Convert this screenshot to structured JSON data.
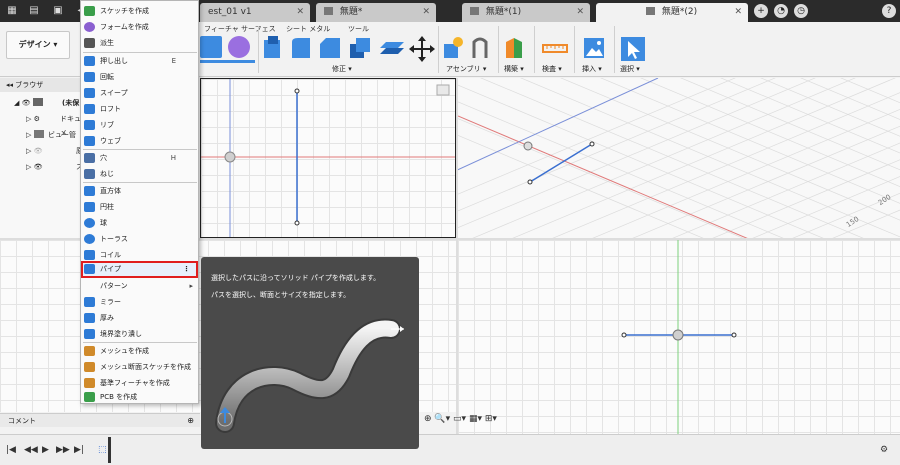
{
  "tabs": [
    {
      "label": "est_01 v1"
    },
    {
      "label": "無題*"
    },
    {
      "label": "無題*(1)"
    },
    {
      "label": "無題*(2)"
    }
  ],
  "toolbar": {
    "workspace_label": "デザイン ▾",
    "subtabs": [
      "フィーチャ サーフェス",
      "シート メタル",
      "ツール"
    ],
    "groups": [
      "修正 ▾",
      "アセンブリ ▾",
      "構築 ▾",
      "検査 ▾",
      "挿入 ▾",
      "選択 ▾"
    ]
  },
  "browser": {
    "title": "ブラウザ",
    "items": [
      "(未保",
      "ドキュメ",
      "ビュー管",
      "原",
      "ス"
    ]
  },
  "comments_label": "コメント",
  "menu": {
    "items": [
      {
        "label": "スケッチを作成",
        "shortcut": "",
        "icon_color": "#3a9e4a"
      },
      {
        "label": "フォームを作成",
        "shortcut": "",
        "icon_color": "#8a5fd0"
      },
      {
        "label": "派生",
        "shortcut": "",
        "icon_color": "#555555"
      },
      {
        "label": "押し出し",
        "shortcut": "E",
        "icon_color": "#2e7bd6"
      },
      {
        "label": "回転",
        "shortcut": "",
        "icon_color": "#2e7bd6"
      },
      {
        "label": "スイープ",
        "shortcut": "",
        "icon_color": "#2e7bd6"
      },
      {
        "label": "ロフト",
        "shortcut": "",
        "icon_color": "#2e7bd6"
      },
      {
        "label": "リブ",
        "shortcut": "",
        "icon_color": "#2e7bd6"
      },
      {
        "label": "ウェブ",
        "shortcut": "",
        "icon_color": "#2e7bd6"
      },
      {
        "label": "穴",
        "shortcut": "H",
        "icon_color": "#4a6fa5"
      },
      {
        "label": "ねじ",
        "shortcut": "",
        "icon_color": "#4a6fa5"
      },
      {
        "label": "直方体",
        "shortcut": "",
        "icon_color": "#2e7bd6"
      },
      {
        "label": "円柱",
        "shortcut": "",
        "icon_color": "#2e7bd6"
      },
      {
        "label": "球",
        "shortcut": "",
        "icon_color": "#2e7bd6"
      },
      {
        "label": "トーラス",
        "shortcut": "",
        "icon_color": "#2e7bd6"
      },
      {
        "label": "コイル",
        "shortcut": "",
        "icon_color": "#2e7bd6"
      },
      {
        "label": "パイプ",
        "shortcut": "",
        "icon_color": "#2e7bd6"
      },
      {
        "label": "パターン",
        "shortcut": "▸",
        "icon_color": ""
      },
      {
        "label": "ミラー",
        "shortcut": "",
        "icon_color": "#2e7bd6"
      },
      {
        "label": "厚み",
        "shortcut": "",
        "icon_color": "#2e7bd6"
      },
      {
        "label": "境界塗り潰し",
        "shortcut": "",
        "icon_color": "#2e7bd6"
      },
      {
        "label": "メッシュを作成",
        "shortcut": "",
        "icon_color": "#d08a2a"
      },
      {
        "label": "メッシュ断面スケッチを作成",
        "shortcut": "",
        "icon_color": "#d08a2a"
      },
      {
        "label": "基準フィーチャを作成",
        "shortcut": "",
        "icon_color": "#d08a2a"
      },
      {
        "label": "PCB を作成",
        "shortcut": "",
        "icon_color": "#3a9e4a"
      }
    ],
    "pipe_more": "⋮"
  },
  "tooltip": {
    "line1": "選択したパスに沿ってソリッド パイプを作成します。",
    "line2": "パスを選択し、断面とサイズを指定します。"
  },
  "iso_labels": [
    "200",
    "150"
  ]
}
